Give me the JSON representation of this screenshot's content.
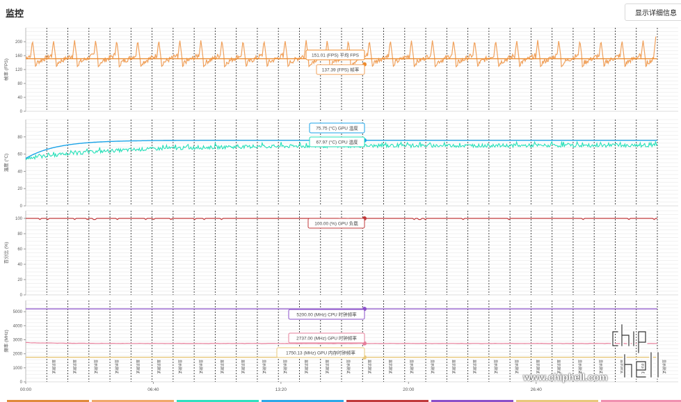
{
  "page_title": "监控",
  "detail_button": "显示详细信息",
  "watermark_text": "www.chiphell.com",
  "logo_text": "chip hell",
  "marker_label": "显示测试",
  "colors": {
    "fps_avg": "#ee8a2a",
    "fps_frame": "#f0a05a",
    "gpu_temp": "#1aa3e8",
    "cpu_temp": "#23e0b8",
    "gpu_load": "#c0393b",
    "cpu_clock": "#8a4fc9",
    "gpu_clock": "#e67e9a",
    "gpu_mem_clock": "#e8c87a",
    "bottom_bar": [
      "#e08a3a",
      "#f0a86a",
      "#2ee0c0",
      "#2ba8e8",
      "#c0393b",
      "#8a4fc9",
      "#e8c87a",
      "#f090b0"
    ]
  },
  "chart_data": [
    {
      "type": "line",
      "ylabel": "帧率 (FPS)",
      "ylim": [
        0,
        240
      ],
      "yticks": [
        0,
        40,
        80,
        120,
        160,
        200
      ],
      "xlim_minutes": [
        0,
        33
      ],
      "xticks": [
        "00:00",
        "06:40",
        "13:20",
        "20:00",
        "26:40"
      ],
      "series": [
        {
          "name": "平均 FPS",
          "unit": "FPS",
          "cursor_value": "151.01",
          "shape": "flat",
          "values": [
            151.0,
            151.0
          ]
        },
        {
          "name": "帧率",
          "unit": "FPS",
          "cursor_value": "137.39",
          "shape": "sawtooth",
          "min": 128,
          "max": 205,
          "end": 215
        }
      ]
    },
    {
      "type": "line",
      "ylabel": "温度 (°C)",
      "ylim": [
        0,
        100
      ],
      "yticks": [
        0,
        20,
        40,
        60,
        80
      ],
      "series": [
        {
          "name": "GPU 温度",
          "unit": "°C",
          "cursor_value": "75.75",
          "start": 55,
          "plateau": 76
        },
        {
          "name": "CPU 温度",
          "unit": "°C",
          "cursor_value": "67.97",
          "start": 55,
          "plateau": 70
        }
      ]
    },
    {
      "type": "line",
      "ylabel": "百分比 (%)",
      "ylim": [
        0,
        110
      ],
      "yticks": [
        0,
        20,
        40,
        60,
        80,
        100
      ],
      "series": [
        {
          "name": "GPU 负载",
          "unit": "%",
          "cursor_value": "100.00",
          "level": 100
        }
      ]
    },
    {
      "type": "line",
      "ylabel": "频率 (MHz)",
      "ylim": [
        0,
        5800
      ],
      "yticks": [
        0,
        1000,
        2000,
        3000,
        4000,
        5000
      ],
      "series": [
        {
          "name": "CPU 时钟频率",
          "unit": "MHz",
          "cursor_value": "5200.00",
          "level": 5200
        },
        {
          "name": "GPU 时钟频率",
          "unit": "MHz",
          "cursor_value": "2737.00",
          "level": 2737,
          "start": 2800
        },
        {
          "name": "GPU 内存时钟频率",
          "unit": "MHz",
          "cursor_value": "1750.13",
          "level": 1750
        }
      ]
    }
  ]
}
